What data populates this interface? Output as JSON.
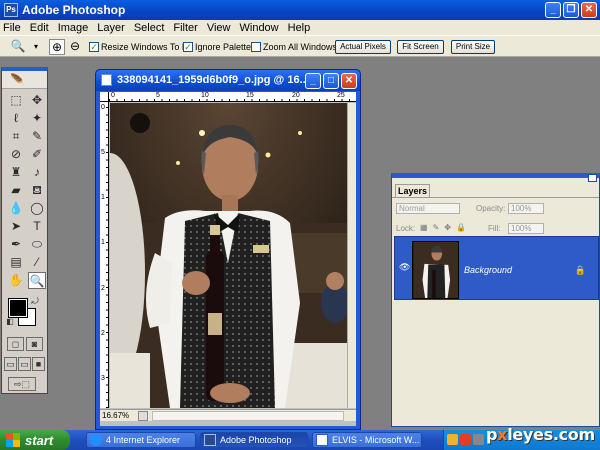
{
  "window": {
    "title": "Adobe Photoshop",
    "icon_text": "Ps",
    "buttons": {
      "minimize": "_",
      "maximize": "❐",
      "close": "✕"
    }
  },
  "menu": [
    "File",
    "Edit",
    "Image",
    "Layer",
    "Select",
    "Filter",
    "View",
    "Window",
    "Help"
  ],
  "options_bar": {
    "tool_icon": "zoom-icon",
    "resize_windows": {
      "label": "Resize Windows To Fit",
      "checked": true
    },
    "ignore_palettes": {
      "label": "Ignore Palettes",
      "checked": true
    },
    "zoom_all": {
      "label": "Zoom All Windows",
      "checked": false
    },
    "buttons": [
      "Actual Pixels",
      "Fit Screen",
      "Print Size"
    ]
  },
  "toolbox": {
    "tools": [
      "marquee-icon",
      "move-icon",
      "lasso-icon",
      "magic-wand-icon",
      "crop-icon",
      "slice-icon",
      "healing-brush-icon",
      "brush-icon",
      "clone-stamp-icon",
      "history-brush-icon",
      "eraser-icon",
      "paint-bucket-icon",
      "blur-icon",
      "dodge-icon",
      "path-select-icon",
      "type-icon",
      "pen-icon",
      "shape-icon",
      "notes-icon",
      "eyedropper-icon",
      "hand-icon",
      "zoom-icon"
    ],
    "foreground_color": "#000000",
    "background_color": "#ffffff"
  },
  "document": {
    "title": "338094141_1959d6b0f9_o.jpg @ 16....",
    "zoom": "16.67%",
    "ruler_top": [
      "0",
      "5",
      "10",
      "15",
      "20",
      "25"
    ],
    "ruler_left": [
      "0",
      "5",
      "1",
      "1",
      "2",
      "2",
      "3"
    ]
  },
  "layers_panel": {
    "tab": "Layers",
    "blend_mode": "Normal",
    "opacity_label": "Opacity:",
    "opacity_value": "100%",
    "lock_label": "Lock:",
    "fill_label": "Fill:",
    "fill_value": "100%",
    "layers": [
      {
        "name": "Background",
        "visible": true,
        "locked": true
      }
    ]
  },
  "taskbar": {
    "start": "start",
    "tasks": [
      "4 Internet Explorer",
      "Adobe Photoshop",
      "ELVIS - Microsoft W..."
    ],
    "active_task": 1
  },
  "watermark": {
    "prefix": "p",
    "x": "x",
    "suffix": "leyes.com"
  },
  "colors": {
    "titlebar": "#0a4ed0",
    "taskbar": "#2552b8",
    "start": "#2f8a2f",
    "selected_layer": "#2e5bc8"
  }
}
